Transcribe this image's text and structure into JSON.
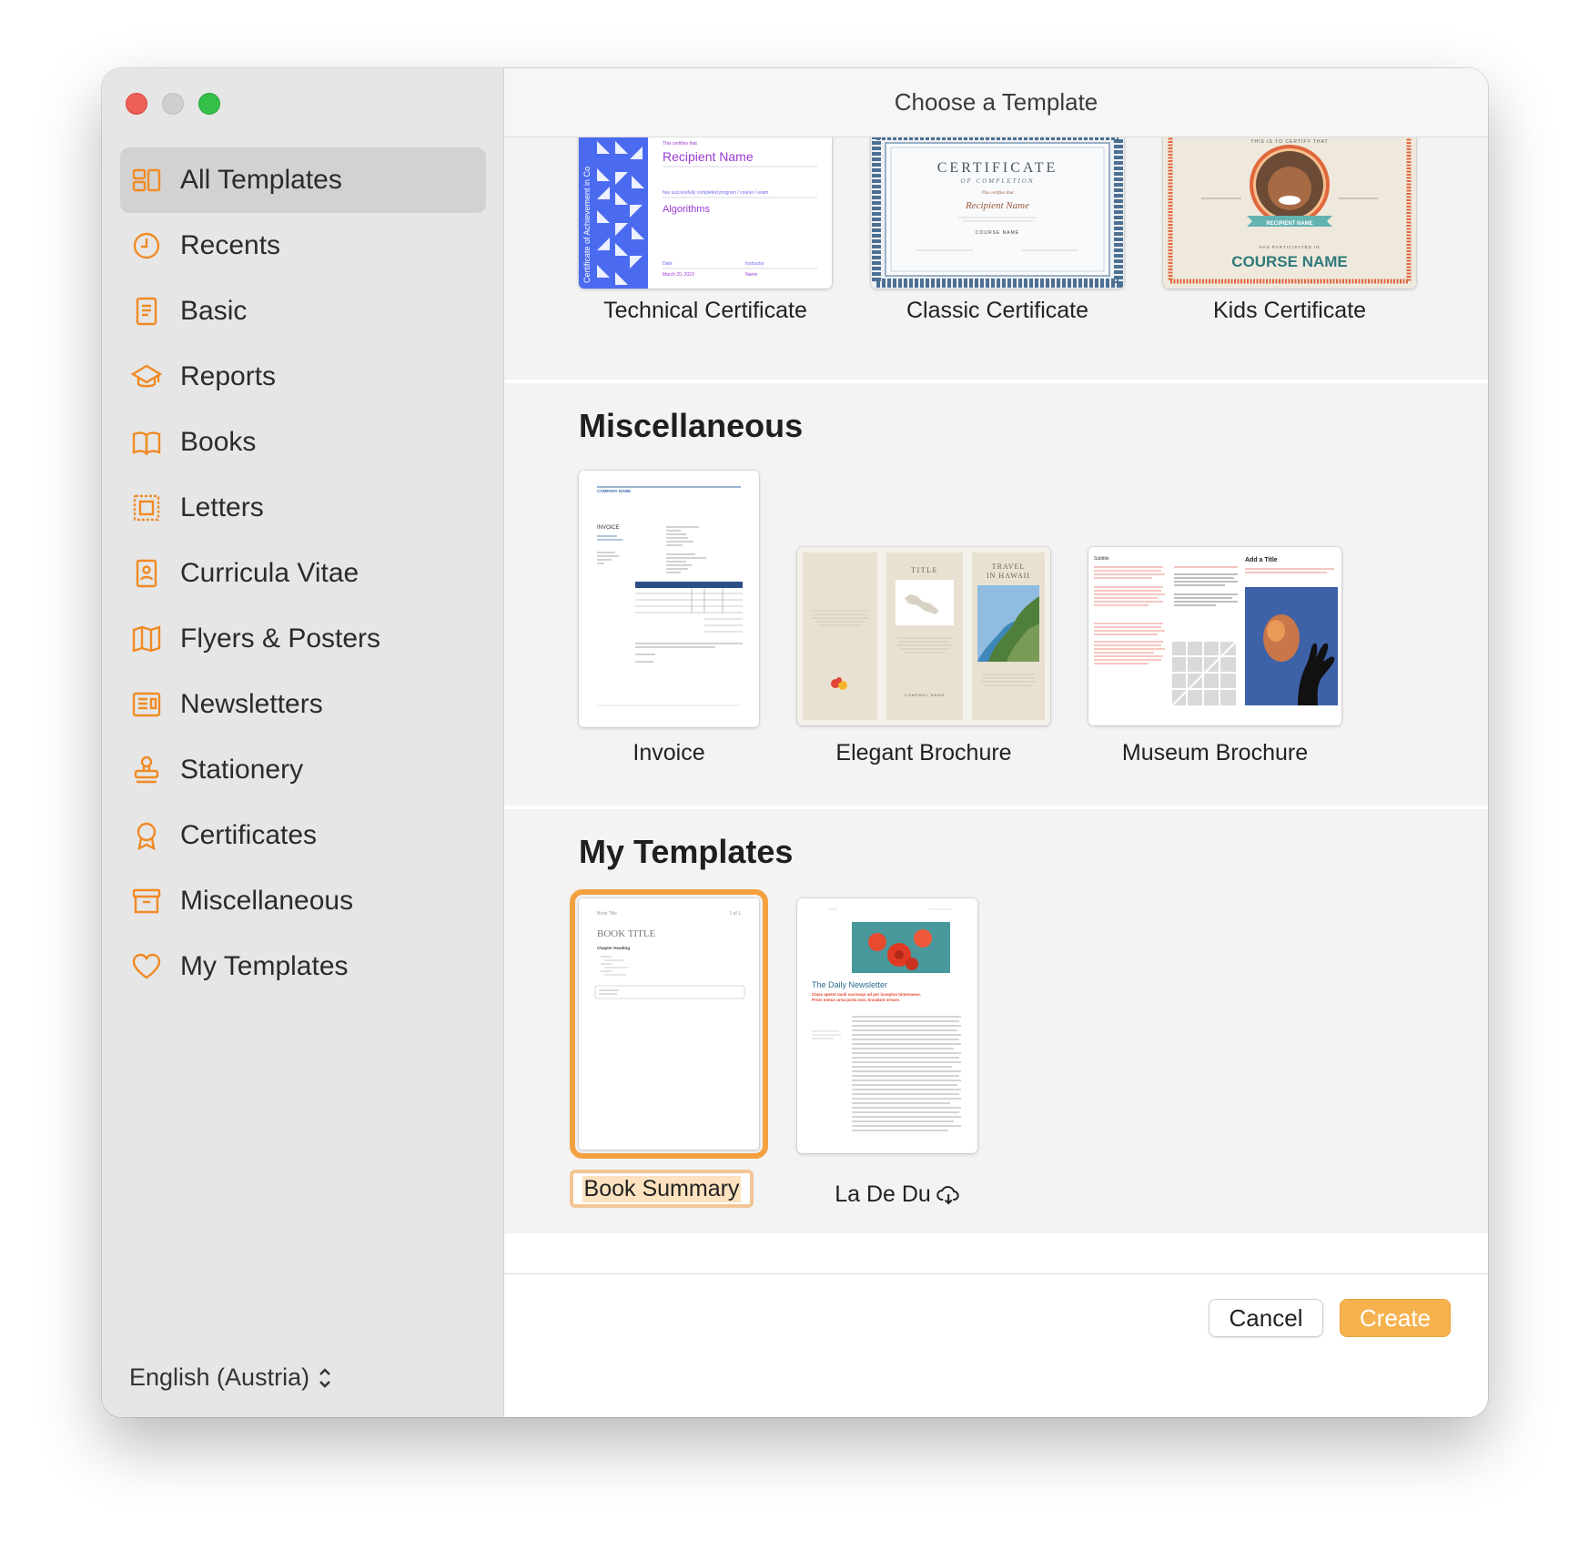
{
  "window": {
    "title": "Choose a Template"
  },
  "sidebar": {
    "items": [
      {
        "label": "All Templates",
        "icon": "grid-icon",
        "active": true
      },
      {
        "label": "Recents",
        "icon": "clock-icon"
      },
      {
        "label": "Basic",
        "icon": "document-icon"
      },
      {
        "label": "Reports",
        "icon": "graduation-cap-icon"
      },
      {
        "label": "Books",
        "icon": "book-icon"
      },
      {
        "label": "Letters",
        "icon": "stamp-letter-icon"
      },
      {
        "label": "Curricula Vitae",
        "icon": "person-document-icon"
      },
      {
        "label": "Flyers & Posters",
        "icon": "map-folded-icon"
      },
      {
        "label": "Newsletters",
        "icon": "newspaper-icon"
      },
      {
        "label": "Stationery",
        "icon": "rubber-stamp-icon"
      },
      {
        "label": "Certificates",
        "icon": "ribbon-award-icon"
      },
      {
        "label": "Miscellaneous",
        "icon": "archive-box-icon"
      },
      {
        "label": "My Templates",
        "icon": "heart-icon"
      }
    ],
    "language": "English (Austria)"
  },
  "sections": {
    "certificates": {
      "templates": [
        {
          "label": "Technical Certificate",
          "preview": {
            "side_text": "Certificate of Achievement in Co",
            "certifies": "This certifies that",
            "name": "Recipient Name",
            "completed": "has successfully completed program / course / exam",
            "course": "Algorithms",
            "date_label": "Date",
            "instructor_label": "Instructor",
            "date_value": "March 20, 2023",
            "instructor_value": "Name"
          }
        },
        {
          "label": "Classic Certificate",
          "preview": {
            "heading": "CERTIFICATE",
            "sub": "OF COMPLETION",
            "certify": "This certifies that",
            "name": "Recipient Name",
            "course": "COURSE NAME"
          }
        },
        {
          "label": "Kids Certificate",
          "preview": {
            "top": "THIS IS TO CERTIFY THAT",
            "banner": "RECIPIENT NAME",
            "participated": "HAS PARTICIPATED IN",
            "course": "COURSE NAME"
          }
        }
      ]
    },
    "miscellaneous": {
      "title": "Miscellaneous",
      "templates": [
        {
          "label": "Invoice",
          "preview": {
            "company": "COMPANY NAME",
            "doc": "INVOICE"
          }
        },
        {
          "label": "Elegant Brochure",
          "preview": {
            "panel_title": "TITLE",
            "travel": "TRAVEL",
            "hawaii": "IN HAWAII",
            "company": "COMPANY NAME"
          }
        },
        {
          "label": "Museum Brochure",
          "preview": {
            "subtitle": "Subtitle",
            "add_title": "Add a Title"
          }
        }
      ]
    },
    "my_templates": {
      "title": "My Templates",
      "templates": [
        {
          "label": "Book Summary",
          "selected": true,
          "preview": {
            "small_title": "Book Title",
            "page": "1 of 1",
            "title": "BOOK TITLE",
            "heading": "Chapter Heading"
          }
        },
        {
          "label": "La De Du",
          "cloud": true,
          "preview": {
            "title": "The Daily Newsletter",
            "subtitle1": "Class aptent taciti sociosqu ad per inceptos himenaeos.",
            "subtitle2": "Proin metus urna porta non, tincidunt ornare."
          }
        }
      ]
    }
  },
  "footer": {
    "cancel": "Cancel",
    "create": "Create"
  },
  "colors": {
    "accent": "#f6b24f",
    "sidebar_icon": "#f08a24",
    "selection": "#f4a03f",
    "tech_blue": "#4a6bf0",
    "tech_purple": "#9b3ad1",
    "classic_frame": "#4c6f93",
    "kids_border": "#e0663c"
  }
}
